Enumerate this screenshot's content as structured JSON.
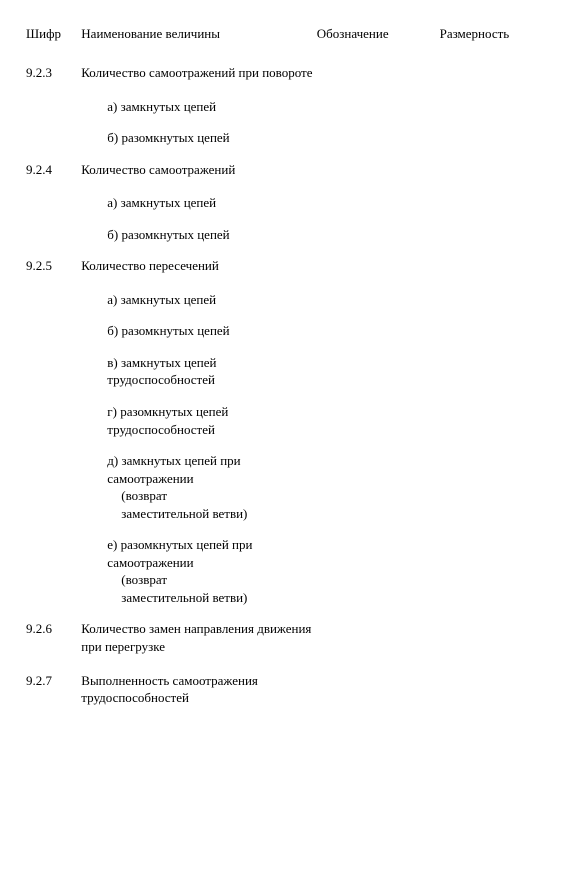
{
  "headers": {
    "h1": "Шифр",
    "h2": "Наименование величины",
    "h3": "Обозначение",
    "h4": "Размерность"
  },
  "rows": [
    {
      "num": "9.2.3",
      "txt": "Количество самоотражений при повороте"
    },
    {
      "sub": "а) замкнутых цепей"
    },
    {
      "sub": "б) разомкнутых цепей"
    },
    {
      "num": "9.2.4",
      "txt": "Количество самоотражений"
    },
    {
      "sub": "а) замкнутых цепей"
    },
    {
      "sub": "б) разомкнутых цепей"
    },
    {
      "num": "9.2.5",
      "txt": "Количество пересечений"
    },
    {
      "sub": "а) замкнутых цепей"
    },
    {
      "sub": "б) разомкнутых цепей"
    },
    {
      "sub": "в) замкнутых цепей трудоспособностей"
    },
    {
      "sub": "г) разомкнутых цепей трудоспособностей"
    },
    {
      "sub": "д) замкнутых цепей при самоотражении",
      "extra": [
        "(возврат",
        "заместительной ветви)"
      ]
    },
    {
      "sub": "е) разомкнутых цепей при самоотражении",
      "extra": [
        "(возврат",
        "заместительной ветви)"
      ]
    },
    {
      "num": "9.2.6",
      "txt": "Количество замен направления движения при перегрузке"
    },
    {
      "num": "9.2.7",
      "txt": "Выполненность самоотражения трудоспособностей"
    }
  ]
}
